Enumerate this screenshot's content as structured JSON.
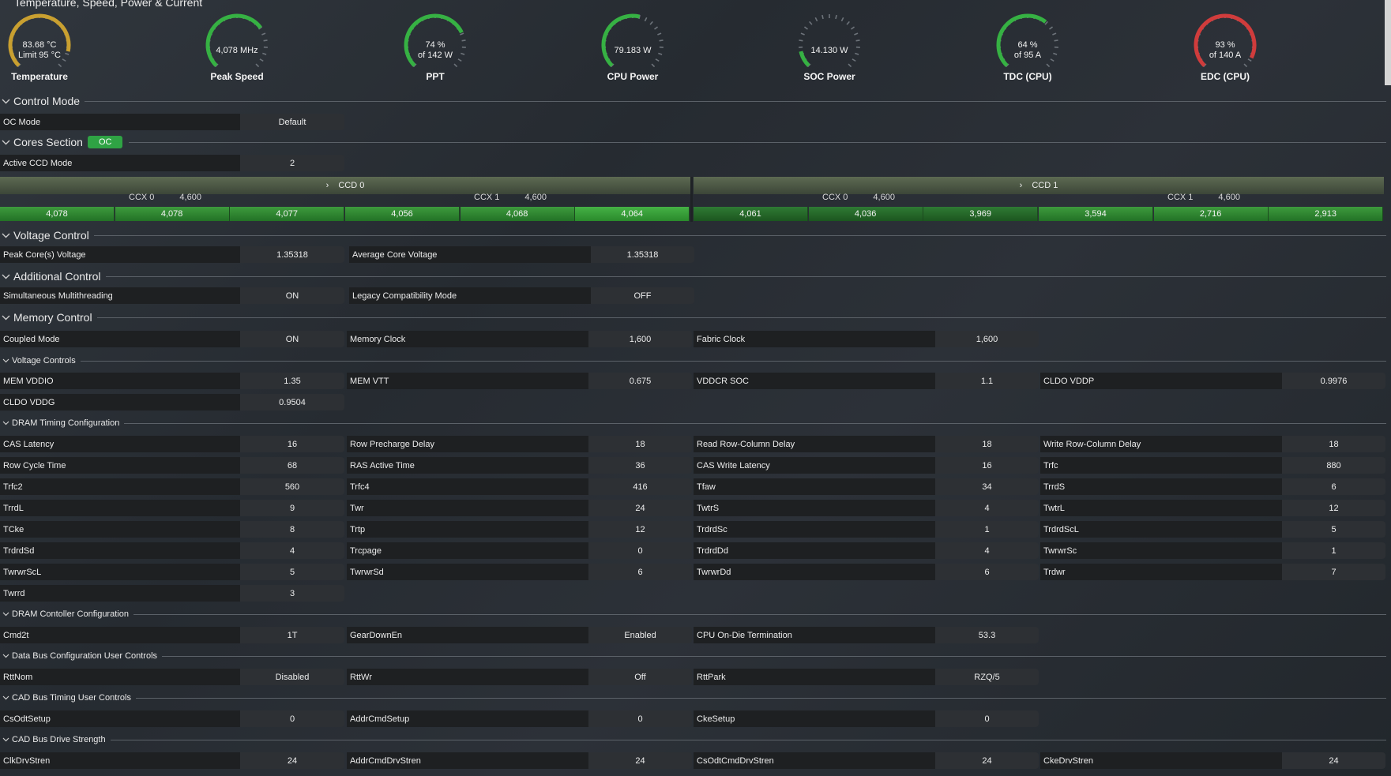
{
  "header": {
    "title": "Temperature, Speed, Power & Current"
  },
  "gauges": [
    {
      "id": "temp",
      "line1": "83.68 °C",
      "line2": "Limit 95 °C",
      "label": "Temperature",
      "fraction": 0.88,
      "color": "#c9a030"
    },
    {
      "id": "speed",
      "line1": "4,078  MHz",
      "line2": "",
      "label": "Peak Speed",
      "fraction": 0.7,
      "color": "#36b143"
    },
    {
      "id": "ppt",
      "line1": "74 %",
      "line2": "of 142 W",
      "label": "PPT",
      "fraction": 0.74,
      "color": "#36b143"
    },
    {
      "id": "cpupower",
      "line1": "79.183 W",
      "line2": "",
      "label": "CPU Power",
      "fraction": 0.55,
      "color": "#36b143"
    },
    {
      "id": "socpower",
      "line1": "14.130 W",
      "line2": "",
      "label": "SOC Power",
      "fraction": 0.12,
      "color": "#36b143"
    },
    {
      "id": "tdc",
      "line1": "64 %",
      "line2": "of 95 A",
      "label": "TDC (CPU)",
      "fraction": 0.64,
      "color": "#36b143"
    },
    {
      "id": "edc",
      "line1": "93 %",
      "line2": "of 140 A",
      "label": "EDC (CPU)",
      "fraction": 0.93,
      "color": "#d03c3c"
    }
  ],
  "sections": {
    "control_mode": "Control Mode",
    "cores": "Cores Section",
    "cores_badge": "OC",
    "voltage_control": "Voltage Control",
    "additional_control": "Additional Control",
    "memory_control": "Memory Control",
    "voltage_controls": "Voltage Controls",
    "dram_timing": "DRAM Timing Configuration",
    "dram_controller": "DRAM Contoller Configuration",
    "data_bus": "Data Bus Configuration User Controls",
    "cad_timing": "CAD Bus Timing User Controls",
    "cad_drive": "CAD Bus Drive Strength"
  },
  "fields": {
    "oc_mode": {
      "label": "OC Mode",
      "value": "Default"
    },
    "active_ccd": {
      "label": "Active CCD Mode",
      "value": "2"
    },
    "peak_voltage": {
      "label": "Peak Core(s) Voltage",
      "value": "1.35318"
    },
    "avg_voltage": {
      "label": "Average Core Voltage",
      "value": "1.35318"
    },
    "smt": {
      "label": "Simultaneous Multithreading",
      "value": "ON"
    },
    "legacy": {
      "label": "Legacy Compatibility Mode",
      "value": "OFF"
    },
    "coupled": {
      "label": "Coupled Mode",
      "value": "ON"
    },
    "memclock": {
      "label": "Memory Clock",
      "value": "1,600"
    },
    "fclk": {
      "label": "Fabric Clock",
      "value": "1,600"
    },
    "memvddio": {
      "label": "MEM VDDIO",
      "value": "1.35"
    },
    "memvtt": {
      "label": "MEM VTT",
      "value": "0.675"
    },
    "vddcrsoc": {
      "label": "VDDCR SOC",
      "value": "1.1"
    },
    "cldovddp": {
      "label": "CLDO VDDP",
      "value": "0.9976"
    },
    "cldovddg": {
      "label": "CLDO VDDG",
      "value": "0.9504"
    },
    "cas": {
      "label": "CAS Latency",
      "value": "16"
    },
    "rp": {
      "label": "Row Precharge Delay",
      "value": "18"
    },
    "rcdrd": {
      "label": "Read Row-Column Delay",
      "value": "18"
    },
    "rcdwr": {
      "label": "Write Row-Column Delay",
      "value": "18"
    },
    "rc": {
      "label": "Row Cycle Time",
      "value": "68"
    },
    "ras": {
      "label": "RAS Active Time",
      "value": "36"
    },
    "cwl": {
      "label": "CAS Write Latency",
      "value": "16"
    },
    "trfc": {
      "label": "Trfc",
      "value": "880"
    },
    "trfc2": {
      "label": "Trfc2",
      "value": "560"
    },
    "trfc4": {
      "label": "Trfc4",
      "value": "416"
    },
    "tfaw": {
      "label": "Tfaw",
      "value": "34"
    },
    "trrds": {
      "label": "TrrdS",
      "value": "6"
    },
    "trrdl": {
      "label": "TrrdL",
      "value": "9"
    },
    "twr": {
      "label": "Twr",
      "value": "24"
    },
    "twtrs": {
      "label": "TwtrS",
      "value": "4"
    },
    "twtrl": {
      "label": "TwtrL",
      "value": "12"
    },
    "tcke": {
      "label": "TCke",
      "value": "8"
    },
    "trtp": {
      "label": "Trtp",
      "value": "12"
    },
    "trdrdsc": {
      "label": "TrdrdSc",
      "value": "1"
    },
    "trdrdscl": {
      "label": "TrdrdScL",
      "value": "5"
    },
    "trdrdsd": {
      "label": "TrdrdSd",
      "value": "4"
    },
    "trcpage": {
      "label": "Trcpage",
      "value": "0"
    },
    "trdrddd": {
      "label": "TrdrdDd",
      "value": "4"
    },
    "twrwrsc": {
      "label": "TwrwrSc",
      "value": "1"
    },
    "twrwrscl": {
      "label": "TwrwrScL",
      "value": "5"
    },
    "twrwrsd": {
      "label": "TwrwrSd",
      "value": "6"
    },
    "twrwrdd": {
      "label": "TwrwrDd",
      "value": "6"
    },
    "trdwr": {
      "label": "Trdwr",
      "value": "7"
    },
    "twrrd": {
      "label": "Twrrd",
      "value": "3"
    },
    "cmd2t": {
      "label": "Cmd2t",
      "value": "1T"
    },
    "geardown": {
      "label": "GearDownEn",
      "value": "Enabled"
    },
    "procodt": {
      "label": "CPU On-Die Termination",
      "value": "53.3"
    },
    "rttnom": {
      "label": "RttNom",
      "value": "Disabled"
    },
    "rttwr": {
      "label": "RttWr",
      "value": "Off"
    },
    "rttpark": {
      "label": "RttPark",
      "value": "RZQ/5"
    },
    "csodtsetup": {
      "label": "CsOdtSetup",
      "value": "0"
    },
    "addrcmdsetup": {
      "label": "AddrCmdSetup",
      "value": "0"
    },
    "ckesetup": {
      "label": "CkeSetup",
      "value": "0"
    },
    "clkdrv": {
      "label": "ClkDrvStren",
      "value": "24"
    },
    "addrcmddrv": {
      "label": "AddrCmdDrvStren",
      "value": "24"
    },
    "csodtcmddrv": {
      "label": "CsOdtCmdDrvStren",
      "value": "24"
    },
    "ckedrv": {
      "label": "CkeDrvStren",
      "value": "24"
    }
  },
  "ccds": [
    {
      "name": "CCD 0",
      "ccx": [
        {
          "name": "CCX 0",
          "freq": "4,600",
          "cores": [
            "4,078",
            "4,078",
            "4,077"
          ]
        },
        {
          "name": "CCX 1",
          "freq": "4,600",
          "cores": [
            "4,056",
            "4,068",
            "4,064"
          ]
        }
      ]
    },
    {
      "name": "CCD 1",
      "ccx": [
        {
          "name": "CCX 0",
          "freq": "4,600",
          "cores": [
            "4,061",
            "4,036",
            "3,969"
          ]
        },
        {
          "name": "CCX 1",
          "freq": "4,600",
          "cores": [
            "3,594",
            "2,716",
            "2,913"
          ]
        }
      ]
    }
  ],
  "icons": {
    "collapse": "chevron-down-icon",
    "expand": "chevron-right-icon"
  }
}
